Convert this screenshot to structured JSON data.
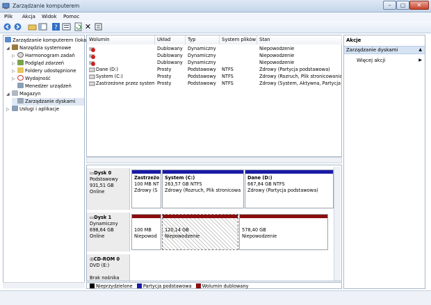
{
  "window": {
    "title": "Zarządzanie komputerem",
    "min": "–",
    "max": "▢",
    "close": "✕"
  },
  "menu": [
    "Plik",
    "Akcja",
    "Widok",
    "Pomoc"
  ],
  "tree": {
    "root": "Zarządzanie komputerem (loka",
    "items": [
      {
        "label": "Narzędzia systemowe",
        "level": 1,
        "expander": "◢"
      },
      {
        "label": "Harmonogram zadań",
        "level": 2,
        "expander": "▷"
      },
      {
        "label": "Podgląd zdarzeń",
        "level": 2,
        "expander": "▷"
      },
      {
        "label": "Foldery udostępnione",
        "level": 2,
        "expander": "▷"
      },
      {
        "label": "Wydajność",
        "level": 2,
        "expander": "▷"
      },
      {
        "label": "Menedżer urządzeń",
        "level": 2,
        "expander": ""
      },
      {
        "label": "Magazyn",
        "level": 1,
        "expander": "◢"
      },
      {
        "label": "Zarządzanie dyskami",
        "level": 2,
        "expander": ""
      },
      {
        "label": "Usługi i aplikacje",
        "level": 1,
        "expander": "▷"
      }
    ]
  },
  "volume_list": {
    "columns": [
      "Wolumin",
      "Układ",
      "Typ",
      "System plików",
      "Stan"
    ],
    "rows": [
      [
        "",
        "Dublowany",
        "Dynamiczny",
        "",
        "Niepowodzenie"
      ],
      [
        "",
        "Dublowany",
        "Dynamiczny",
        "",
        "Niepowodzenie"
      ],
      [
        "",
        "Dublowany",
        "Dynamiczny",
        "",
        "Niepowodzenie"
      ],
      [
        "Dane (D:)",
        "Prosty",
        "Podstawowy",
        "NTFS",
        "Zdrowy (Partycja podstawowa)"
      ],
      [
        "System (C:)",
        "Prosty",
        "Podstawowy",
        "NTFS",
        "Zdrowy (Rozruch, Plik stronicowania"
      ],
      [
        "Zastrzeżone przez system",
        "Prosty",
        "Podstawowy",
        "NTFS",
        "Zdrowy (System, Aktywna, Partycja p"
      ]
    ]
  },
  "disks": [
    {
      "name": "Dysk 0",
      "type": "Podstawowy",
      "size": "931,51 GB",
      "status": "Online",
      "partitions": [
        {
          "name": "Zastrzeżo",
          "size": "100 MB NT",
          "status": "Zdrowy (S",
          "kind": "blue"
        },
        {
          "name": "System (C:)",
          "size": "263,57 GB NTFS",
          "status": "Zdrowy (Rozruch, Plik stronicowa",
          "kind": "blue"
        },
        {
          "name": "Dane (D:)",
          "size": "667,84 GB NTFS",
          "status": "Zdrowy (Partycja podstawowa)",
          "kind": "blue"
        }
      ]
    },
    {
      "name": "Dysk 1",
      "type": "Dynamiczny",
      "size": "698,64 GB",
      "status": "Online",
      "partitions": [
        {
          "name": "",
          "size": "100 MB",
          "status": "Niepowod",
          "kind": "red"
        },
        {
          "name": "",
          "size": "120,14 GB",
          "status": "Niepowodzenie",
          "kind": "red-hatched"
        },
        {
          "name": "",
          "size": "578,40 GB",
          "status": "Niepowodzenie",
          "kind": "red"
        }
      ]
    },
    {
      "name": "CD-ROM 0",
      "type": "DVD (E:)",
      "size": "",
      "status": "",
      "media": "Brak nośnika"
    }
  ],
  "legend": [
    {
      "label": "Nieprzydzielone",
      "color": "#000000"
    },
    {
      "label": "Partycja podstawowa",
      "color": "#1a1aa6"
    },
    {
      "label": "Wolumin dublowany",
      "color": "#8b0d0d"
    }
  ],
  "actions": {
    "header": "Akcje",
    "section": "Zarządzanie dyskami",
    "more": "Więcej akcji"
  }
}
